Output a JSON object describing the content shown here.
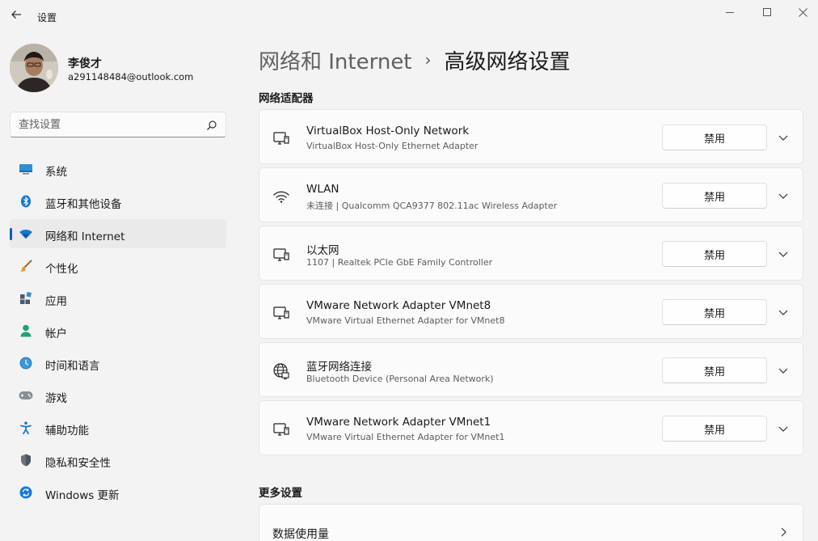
{
  "window": {
    "title": "设置",
    "back_icon": "arrow-left-icon",
    "controls": [
      "minimize-icon",
      "maximize-icon",
      "close-icon"
    ]
  },
  "profile": {
    "name": "李俊才",
    "email": "a291148484@outlook.com"
  },
  "search": {
    "placeholder": "查找设置",
    "icon": "search-icon"
  },
  "sidebar": {
    "items": [
      {
        "label": "系统",
        "icon": "system-display-icon",
        "active": false
      },
      {
        "label": "蓝牙和其他设备",
        "icon": "bluetooth-icon",
        "active": false
      },
      {
        "label": "网络和 Internet",
        "icon": "wifi-icon",
        "active": true
      },
      {
        "label": "个性化",
        "icon": "paintbrush-icon",
        "active": false
      },
      {
        "label": "应用",
        "icon": "apps-icon",
        "active": false
      },
      {
        "label": "帐户",
        "icon": "person-icon",
        "active": false
      },
      {
        "label": "时间和语言",
        "icon": "globe-clock-icon",
        "active": false
      },
      {
        "label": "游戏",
        "icon": "gamepad-icon",
        "active": false
      },
      {
        "label": "辅助功能",
        "icon": "accessibility-icon",
        "active": false
      },
      {
        "label": "隐私和安全性",
        "icon": "shield-icon",
        "active": false
      },
      {
        "label": "Windows 更新",
        "icon": "sync-icon",
        "active": false
      }
    ]
  },
  "breadcrumb": {
    "parent": "网络和 Internet",
    "separator": "›",
    "current": "高级网络设置"
  },
  "adapters_section": {
    "title": "网络适配器",
    "items": [
      {
        "name": "VirtualBox Host-Only Network",
        "description": "VirtualBox Host-Only Ethernet Adapter",
        "button": "禁用",
        "icon": "ethernet-monitor-icon"
      },
      {
        "name": "WLAN",
        "description": "未连接 | Qualcomm QCA9377 802.11ac Wireless Adapter",
        "button": "禁用",
        "icon": "wifi-icon"
      },
      {
        "name": "以太网",
        "description": "1107 | Realtek PCIe GbE Family Controller",
        "button": "禁用",
        "icon": "ethernet-monitor-icon"
      },
      {
        "name": "VMware Network Adapter VMnet8",
        "description": "VMware Virtual Ethernet Adapter for VMnet8",
        "button": "禁用",
        "icon": "ethernet-monitor-icon"
      },
      {
        "name": "蓝牙网络连接",
        "description": "Bluetooth Device (Personal Area Network)",
        "button": "禁用",
        "icon": "globe-network-icon"
      },
      {
        "name": "VMware Network Adapter VMnet1",
        "description": "VMware Virtual Ethernet Adapter for VMnet1",
        "button": "禁用",
        "icon": "ethernet-monitor-icon"
      }
    ]
  },
  "more_section": {
    "title": "更多设置",
    "items": [
      {
        "label": "数据使用量",
        "icon": "chevron-right-icon"
      }
    ]
  },
  "colors": {
    "accent": "#005fb8",
    "background": "#f3f3f3",
    "card": "#fbfbfb"
  }
}
